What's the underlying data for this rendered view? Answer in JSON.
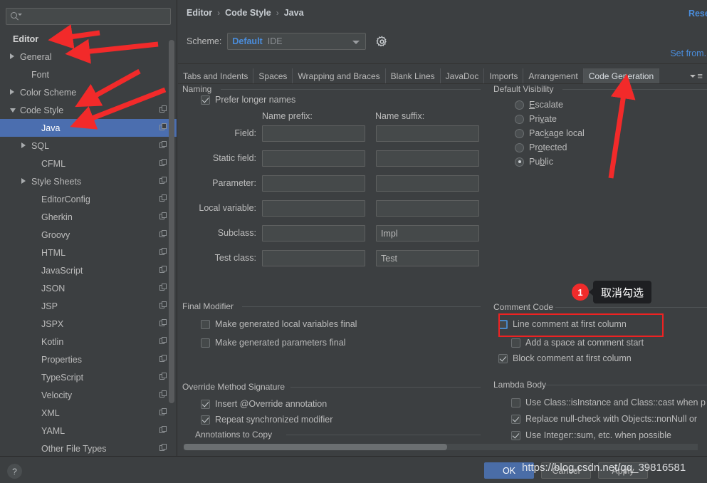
{
  "colors": {
    "accent_blue": "#4a8ddc",
    "selection_blue": "#4b6eaf",
    "annotation_red": "#ee2222",
    "badge_red": "#f02b2b",
    "panel_bg": "#3c3f41",
    "field_bg": "#45494a",
    "tooltip_bg": "#1e1f22"
  },
  "sidebar": {
    "search": {
      "placeholder": "",
      "value": "",
      "icon": "search-icon"
    },
    "items": [
      {
        "label": "Editor",
        "indent": 18,
        "twisty": "none",
        "bold": true,
        "selected": false,
        "copy": false
      },
      {
        "label": "General",
        "indent": 28,
        "twisty": "collapsed",
        "bold": false,
        "selected": false,
        "copy": false
      },
      {
        "label": "Font",
        "indent": 44,
        "twisty": "none",
        "bold": false,
        "selected": false,
        "copy": false
      },
      {
        "label": "Color Scheme",
        "indent": 28,
        "twisty": "collapsed",
        "bold": false,
        "selected": false,
        "copy": false
      },
      {
        "label": "Code Style",
        "indent": 28,
        "twisty": "expanded",
        "bold": false,
        "selected": false,
        "copy": true
      },
      {
        "label": "Java",
        "indent": 58,
        "twisty": "none",
        "bold": false,
        "selected": true,
        "copy": true
      },
      {
        "label": "SQL",
        "indent": 44,
        "twisty": "collapsed",
        "bold": false,
        "selected": false,
        "copy": true
      },
      {
        "label": "CFML",
        "indent": 58,
        "twisty": "none",
        "bold": false,
        "selected": false,
        "copy": true
      },
      {
        "label": "Style Sheets",
        "indent": 44,
        "twisty": "collapsed",
        "bold": false,
        "selected": false,
        "copy": true
      },
      {
        "label": "EditorConfig",
        "indent": 58,
        "twisty": "none",
        "bold": false,
        "selected": false,
        "copy": true
      },
      {
        "label": "Gherkin",
        "indent": 58,
        "twisty": "none",
        "bold": false,
        "selected": false,
        "copy": true
      },
      {
        "label": "Groovy",
        "indent": 58,
        "twisty": "none",
        "bold": false,
        "selected": false,
        "copy": true
      },
      {
        "label": "HTML",
        "indent": 58,
        "twisty": "none",
        "bold": false,
        "selected": false,
        "copy": true
      },
      {
        "label": "JavaScript",
        "indent": 58,
        "twisty": "none",
        "bold": false,
        "selected": false,
        "copy": true
      },
      {
        "label": "JSON",
        "indent": 58,
        "twisty": "none",
        "bold": false,
        "selected": false,
        "copy": true
      },
      {
        "label": "JSP",
        "indent": 58,
        "twisty": "none",
        "bold": false,
        "selected": false,
        "copy": true
      },
      {
        "label": "JSPX",
        "indent": 58,
        "twisty": "none",
        "bold": false,
        "selected": false,
        "copy": true
      },
      {
        "label": "Kotlin",
        "indent": 58,
        "twisty": "none",
        "bold": false,
        "selected": false,
        "copy": true
      },
      {
        "label": "Properties",
        "indent": 58,
        "twisty": "none",
        "bold": false,
        "selected": false,
        "copy": true
      },
      {
        "label": "TypeScript",
        "indent": 58,
        "twisty": "none",
        "bold": false,
        "selected": false,
        "copy": true
      },
      {
        "label": "Velocity",
        "indent": 58,
        "twisty": "none",
        "bold": false,
        "selected": false,
        "copy": true
      },
      {
        "label": "XML",
        "indent": 58,
        "twisty": "none",
        "bold": false,
        "selected": false,
        "copy": true
      },
      {
        "label": "YAML",
        "indent": 58,
        "twisty": "none",
        "bold": false,
        "selected": false,
        "copy": true
      },
      {
        "label": "Other File Types",
        "indent": 58,
        "twisty": "none",
        "bold": false,
        "selected": false,
        "copy": true
      }
    ]
  },
  "header": {
    "breadcrumb": [
      "Editor",
      "Code Style",
      "Java"
    ],
    "separator": "›",
    "reset_link": "Reset",
    "set_from_link": "Set from...",
    "scheme_label": "Scheme:",
    "scheme_name": "Default",
    "scheme_scope": "IDE",
    "gear_icon": "gear-icon"
  },
  "tabs": [
    {
      "label": "Tabs and Indents",
      "active": false
    },
    {
      "label": "Spaces",
      "active": false
    },
    {
      "label": "Wrapping and Braces",
      "active": false
    },
    {
      "label": "Blank Lines",
      "active": false
    },
    {
      "label": "JavaDoc",
      "active": false
    },
    {
      "label": "Imports",
      "active": false
    },
    {
      "label": "Arrangement",
      "active": false
    },
    {
      "label": "Code Generation",
      "active": true
    }
  ],
  "content": {
    "naming": {
      "title": "Naming",
      "prefer_longer_names": {
        "label": "Prefer longer names",
        "checked": true
      },
      "col_prefix": "Name prefix:",
      "col_suffix": "Name suffix:",
      "rows": [
        {
          "label": "Field:",
          "prefix": "",
          "suffix": ""
        },
        {
          "label": "Static field:",
          "prefix": "",
          "suffix": ""
        },
        {
          "label": "Parameter:",
          "prefix": "",
          "suffix": ""
        },
        {
          "label": "Local variable:",
          "prefix": "",
          "suffix": ""
        },
        {
          "label": "Subclass:",
          "prefix": "",
          "suffix": "Impl"
        },
        {
          "label": "Test class:",
          "prefix": "",
          "suffix": "Test"
        }
      ]
    },
    "final_modifier": {
      "title": "Final Modifier",
      "items": [
        {
          "label": "Make generated local variables final",
          "checked": false
        },
        {
          "label": "Make generated parameters final",
          "checked": false
        }
      ]
    },
    "override_method_signature": {
      "title": "Override Method Signature",
      "items": [
        {
          "label": "Insert @Override annotation",
          "checked": true,
          "mnemonic": "O"
        },
        {
          "label": "Repeat synchronized modifier",
          "checked": true,
          "mnemonic": "s"
        }
      ]
    },
    "annotations_to_copy": {
      "title": "Annotations to Copy",
      "value": ""
    },
    "default_visibility": {
      "title": "Default Visibility",
      "options": [
        {
          "label": "Escalate",
          "selected": false,
          "mnemonic": "E"
        },
        {
          "label": "Private",
          "selected": false,
          "mnemonic": "v"
        },
        {
          "label": "Package local",
          "selected": false,
          "mnemonic": "k"
        },
        {
          "label": "Protected",
          "selected": false,
          "mnemonic": "o"
        },
        {
          "label": "Public",
          "selected": true,
          "mnemonic": "b"
        }
      ]
    },
    "comment_code": {
      "title": "Comment Code",
      "items": [
        {
          "label": "Line comment at first column",
          "checked": false,
          "focused": true,
          "indent": 722
        },
        {
          "label": "Add a space at comment start",
          "checked": false,
          "focused": false,
          "indent": 740
        },
        {
          "label": "Block comment at first column",
          "checked": true,
          "focused": false,
          "indent": 722
        }
      ]
    },
    "lambda_body": {
      "title": "Lambda Body",
      "items": [
        {
          "label": "Use Class::isInstance and Class::cast when p",
          "checked": false
        },
        {
          "label": "Replace null-check with Objects::nonNull or",
          "checked": true
        },
        {
          "label": "Use Integer::sum, etc. when possible",
          "checked": true
        }
      ]
    }
  },
  "footer": {
    "help_icon": "question-mark-icon",
    "ok_label": "OK",
    "cancel_label": "Cancel",
    "apply_label": "Apply"
  },
  "annotation": {
    "badge_number": "1",
    "tooltip_text": "取消勾选",
    "watermark": "https://blog.csdn.net/qq_39816581"
  }
}
